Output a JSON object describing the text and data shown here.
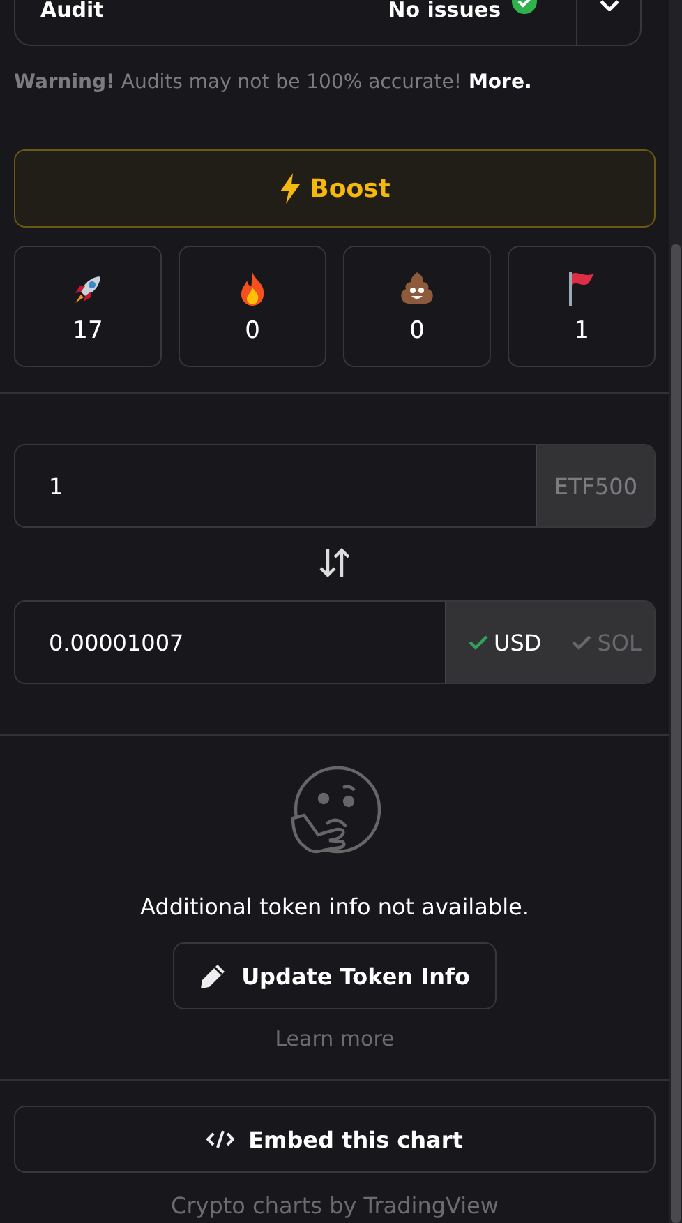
{
  "audit": {
    "label": "Audit",
    "status": "No issues"
  },
  "warning": {
    "text": "**Warning!** Audits may not be 100% accurate!",
    "link": "More."
  },
  "boost": {
    "label": "Boost"
  },
  "reactions": [
    {
      "kind": "rocket",
      "count": "17"
    },
    {
      "kind": "fire",
      "count": "0"
    },
    {
      "kind": "poop",
      "count": "0"
    },
    {
      "kind": "flag",
      "count": "1"
    }
  ],
  "converter": {
    "amount": "1",
    "token": "ETF500",
    "result": "0.00001007",
    "currencies": [
      {
        "label": "USD",
        "selected": true
      },
      {
        "label": "SOL",
        "selected": false
      }
    ]
  },
  "info": {
    "message": "Additional token info not available.",
    "button": "Update Token Info",
    "link": "Learn more"
  },
  "embed": {
    "label": "Embed this chart"
  },
  "footer": "Crypto charts by TradingView"
}
